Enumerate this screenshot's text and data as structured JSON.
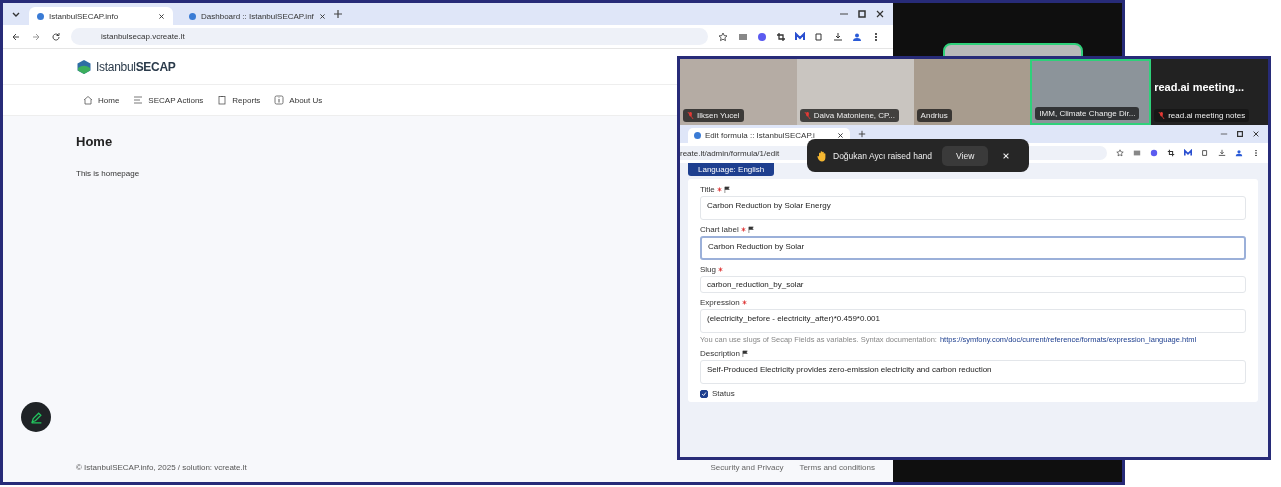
{
  "left_browser": {
    "tabs": [
      {
        "title": "IstanbulSECAP.info",
        "selected": true
      },
      {
        "title": "Dashboard :: IstanbulSECAP.inf",
        "selected": false
      }
    ],
    "url": "istanbulsecap.vcreate.lt",
    "site": {
      "logo": "Istanbul**SECAP**",
      "nav": [
        {
          "label": "Home"
        },
        {
          "label": "SECAP Actions"
        },
        {
          "label": "Reports"
        },
        {
          "label": "About Us"
        }
      ],
      "heading": "Home",
      "body": "This is homepage",
      "footer": "© IstanbulSECAP.info, 2025 / solution: vcreate.lt",
      "footer_links": [
        "Security and Privacy",
        "Terms and conditions"
      ]
    }
  },
  "stage_tile": {
    "speaking": true
  },
  "meeting": {
    "participants": [
      {
        "kind": "video",
        "name": "Ilksen Yucel",
        "muted": true,
        "speaking": false
      },
      {
        "kind": "video",
        "name": "Daiva Matoniene, CP...",
        "muted": true,
        "speaking": false
      },
      {
        "kind": "video",
        "name": "Andrius",
        "muted": false,
        "speaking": false
      },
      {
        "kind": "video",
        "name": "IMM, Climate Change Dir...",
        "muted": false,
        "speaking": true
      },
      {
        "kind": "app",
        "title": "read.ai  meeting...",
        "name": "read.ai meeting notes",
        "muted": true,
        "speaking": false
      }
    ]
  },
  "toast": {
    "text": "Doğukan Aycı raised hand",
    "action": "View"
  },
  "right_browser": {
    "tabs": [
      {
        "title": "Edit formula :: IstanbulSECAP.i",
        "selected": true
      }
    ],
    "url": "reate.lt/admin/formula/1/edit",
    "language_button": "Language: English",
    "fields": [
      {
        "label": "Title",
        "required": true,
        "translatable": true,
        "kind": "textarea",
        "value": "Carbon Reduction by Solar Energy",
        "focused": false
      },
      {
        "label": "Chart label",
        "required": true,
        "translatable": true,
        "kind": "textarea",
        "value": "Carbon Reduction by Solar",
        "focused": true
      },
      {
        "label": "Slug",
        "required": true,
        "translatable": false,
        "kind": "input",
        "value": "carbon_reduction_by_solar",
        "focused": false
      },
      {
        "label": "Expression",
        "required": true,
        "translatable": false,
        "kind": "textarea",
        "value": "(electricity_before - electricity_after)*0.459*0.001",
        "focused": false,
        "help": "You can use slugs of Secap Fields as variables. Syntax documentation:",
        "help_link": "https://symfony.com/doc/current/reference/formats/expression_language.html"
      },
      {
        "label": "Description",
        "required": false,
        "translatable": true,
        "kind": "textarea",
        "value": "Self-Produced Electricity provides zero-emission electricity and carbon reduction",
        "focused": false
      }
    ],
    "status": {
      "label": "Status",
      "checked": true
    }
  }
}
